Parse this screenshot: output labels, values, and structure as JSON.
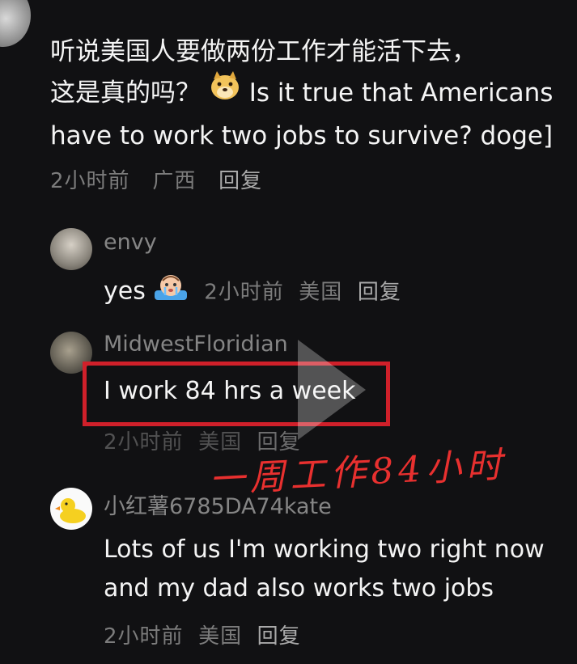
{
  "main_comment": {
    "text_zh_line1": "听说美国人要做两份工作才能活下去，",
    "text_zh_line2": "这是真的吗？",
    "text_en": "Is it true that Americans have to work two jobs to survive? doge]",
    "emoji": "doge-emoji",
    "time": "2小时前",
    "location": "广西",
    "reply_label": "回复"
  },
  "replies": [
    {
      "username": "envy",
      "text": "yes",
      "emoji": "crying-emoji",
      "time": "2小时前",
      "location": "美国",
      "reply_label": "回复"
    },
    {
      "username": "MidwestFloridian",
      "text": "I work 84 hrs a week",
      "time": "2小时前",
      "location": "美国",
      "reply_label": "回复",
      "annotation": "一周工作84小时",
      "highlight_color": "#d0202a"
    },
    {
      "username": "小红薯6785DA74kate",
      "text_line1": "Lots of us I'm working two right now",
      "text_line2": "and my dad also works two jobs",
      "time": "2小时前",
      "location": "美国",
      "reply_label": "回复"
    }
  ],
  "icons": {
    "top_avatar": "user-avatar-icon",
    "play_overlay": "play-icon",
    "duck_avatar": "duck-avatar-icon"
  },
  "colors": {
    "background": "#111113",
    "highlight": "#d0202a",
    "annotation": "#e8302f",
    "meta_text": "#7c7c7c"
  }
}
